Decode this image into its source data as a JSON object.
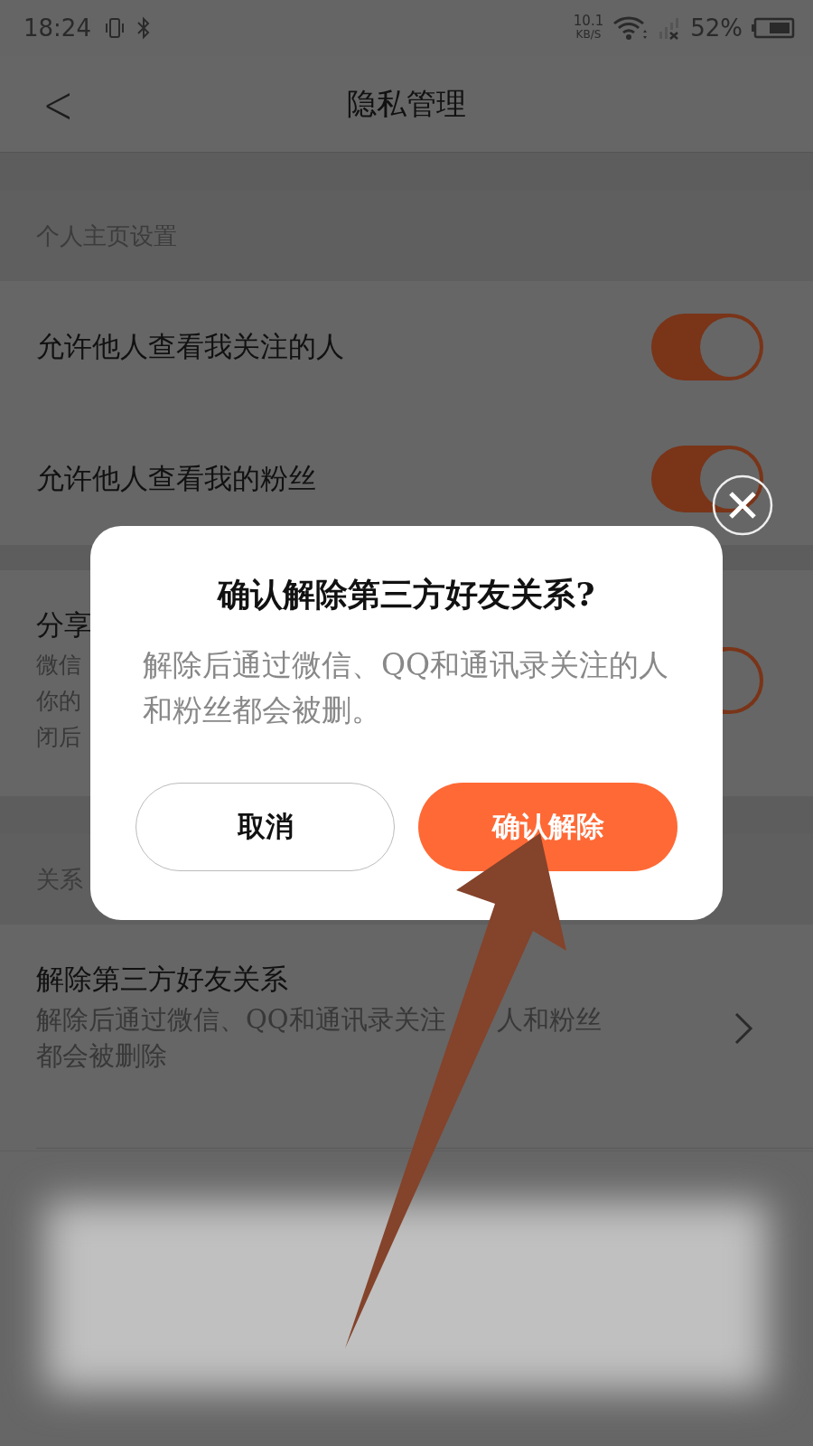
{
  "status_bar": {
    "time": "18:24",
    "speed": "10.1",
    "speed_unit": "KB/S",
    "battery": "52%"
  },
  "header": {
    "back": "<",
    "title": "隐私管理"
  },
  "sections": [
    {
      "title": "个人主页设置",
      "rows": [
        {
          "kind": "toggle",
          "title": "允许他人查看我关注的人",
          "on": true
        },
        {
          "kind": "toggle",
          "title": "允许他人查看我的粉丝",
          "on": true
        }
      ]
    },
    {
      "rows": [
        {
          "kind": "toggle",
          "title": "分享",
          "lines": [
            "微信",
            "你的",
            "闭后"
          ],
          "on": true
        }
      ]
    },
    {
      "title": "关系",
      "rows": [
        {
          "kind": "link",
          "title": "解除第三方好友关系",
          "lines": [
            [
              "解除后通过微信、QQ和通讯录关注",
              "人和粉丝"
            ],
            [
              "都会被删除"
            ]
          ]
        }
      ]
    }
  ],
  "dialog": {
    "title": "确认解除第三方好友关系?",
    "message": "解除后通过微信、QQ和通讯录关注的人和粉丝都会被删。",
    "cancel": "取消",
    "confirm": "确认解除"
  }
}
